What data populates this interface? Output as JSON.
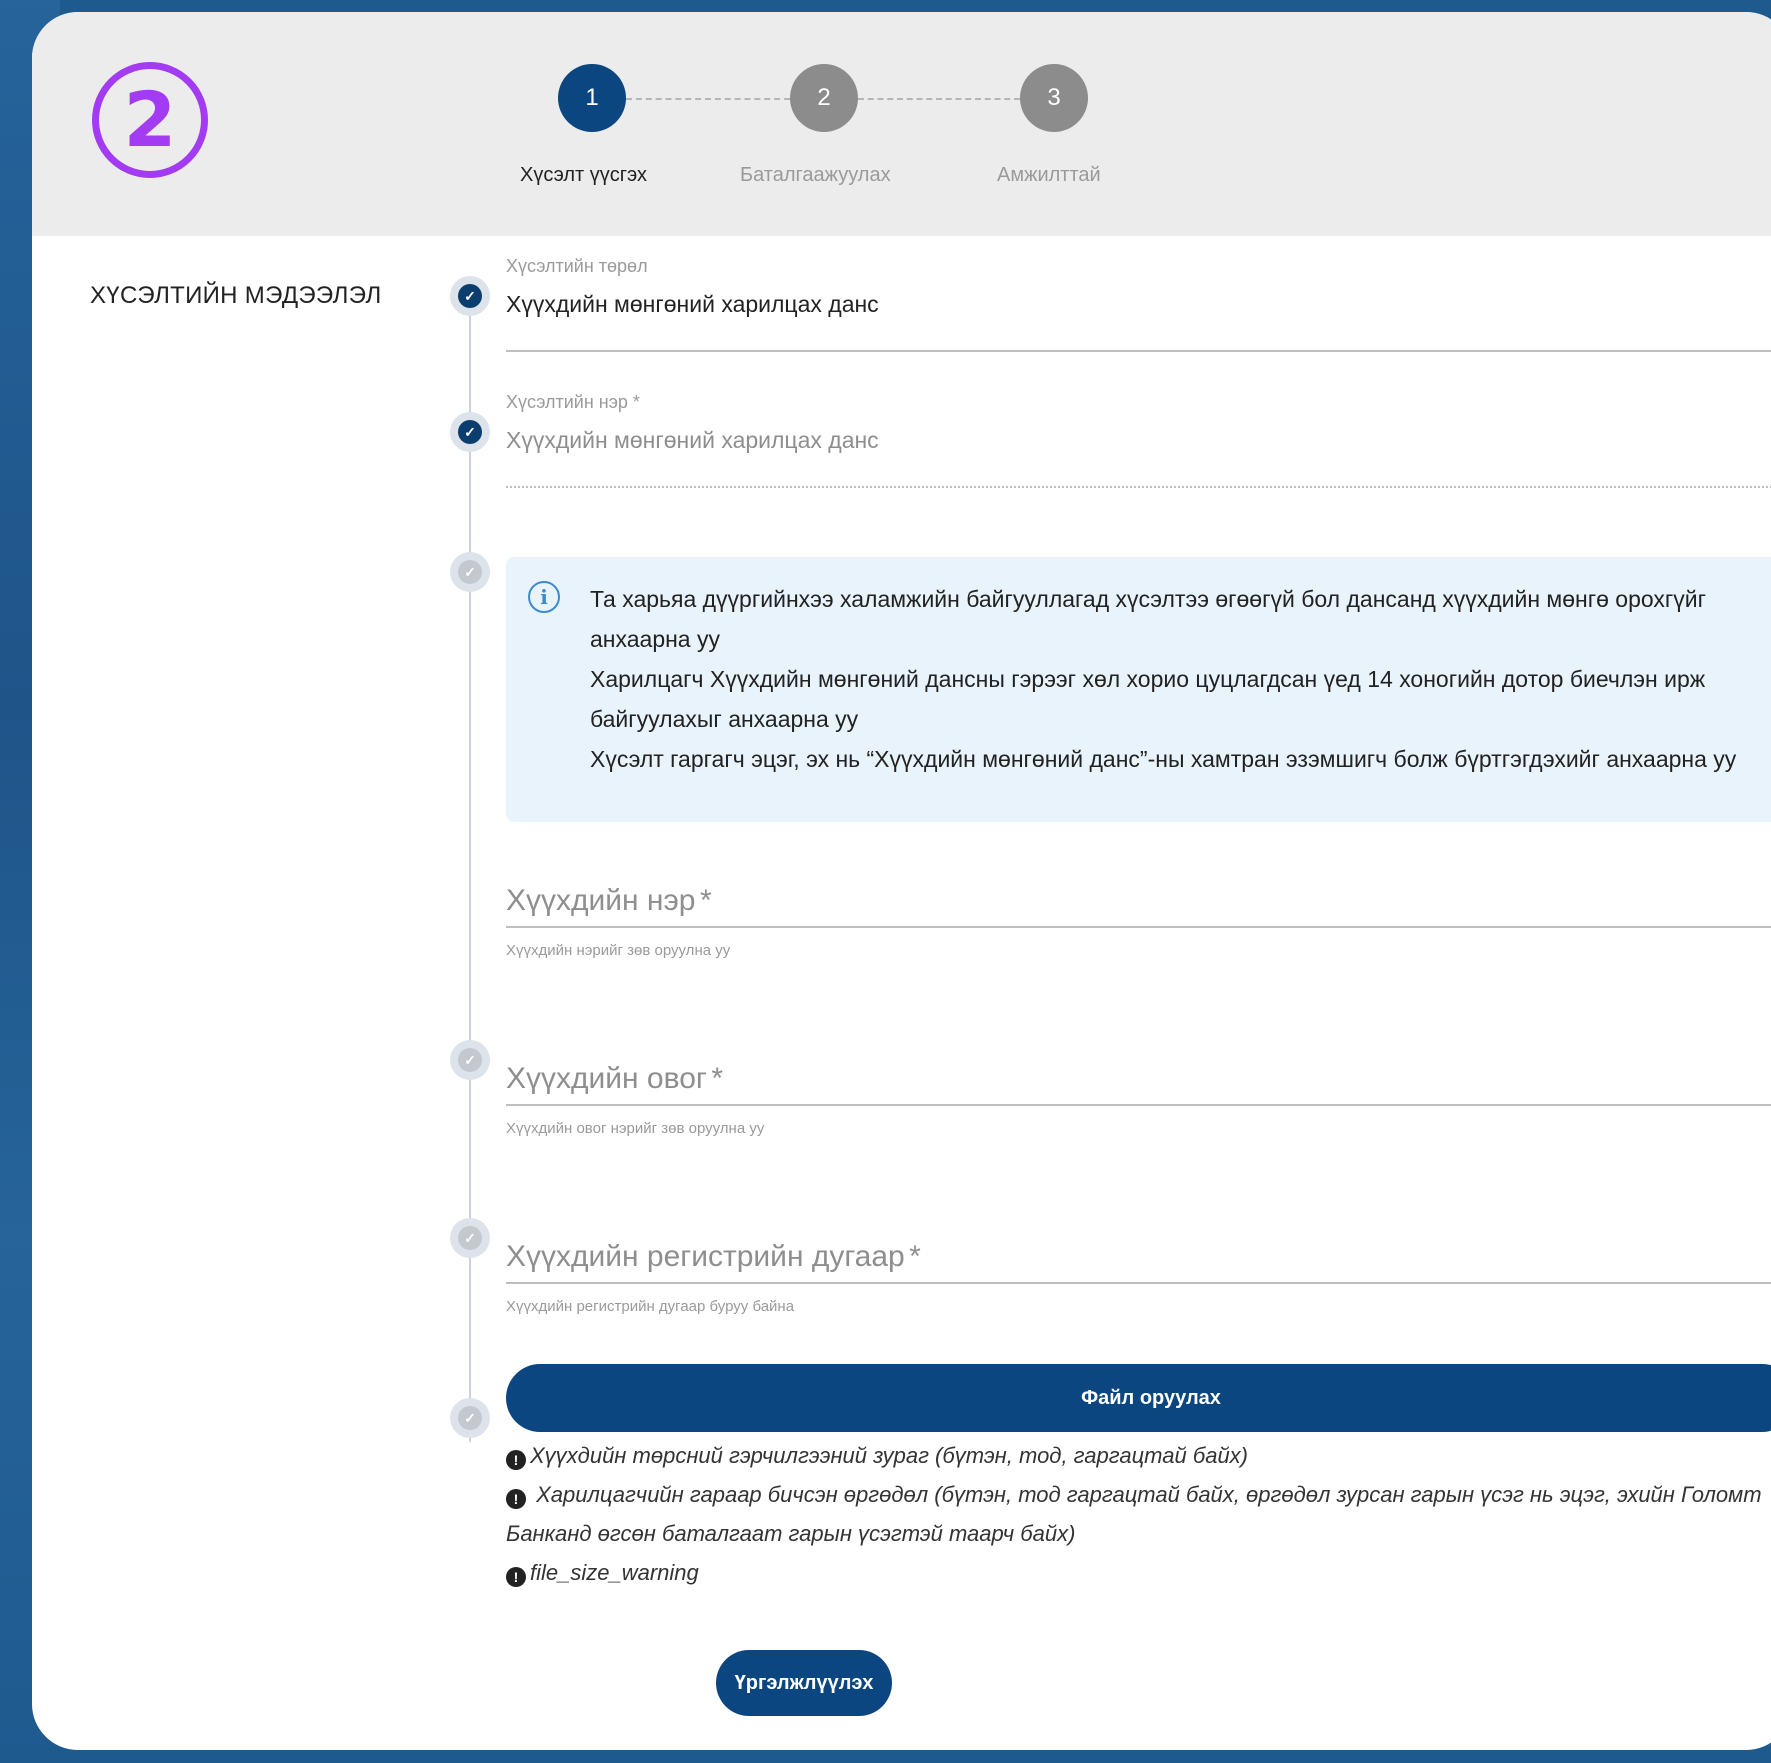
{
  "badge": "2",
  "stepper": {
    "steps": [
      {
        "number": "1",
        "label": "Хүсэлт үүсгэх"
      },
      {
        "number": "2",
        "label": "Баталгаажуулах"
      },
      {
        "number": "3",
        "label": "Амжилттай"
      }
    ],
    "active_step": 1
  },
  "section_title": "ХҮСЭЛТИЙН МЭДЭЭЛЭЛ",
  "request_type": {
    "label": "Хүсэлтийн төрөл",
    "value": "Хүүхдийн мөнгөний харилцах данс"
  },
  "request_name": {
    "label": "Хүсэлтийн нэр *",
    "value": "Хүүхдийн мөнгөний харилцах данс"
  },
  "info": {
    "lines": [
      "Та харьяа дүүргийнхээ халамжийн байгууллагад хүсэлтээ өгөөгүй бол дансанд хүүхдийн мөнгө орохгүйг анхаарна уу",
      "Харилцагч Хүүхдийн мөнгөний дансны гэрээг хөл хорио цуцлагдсан үед 14 хоногийн дотор биечлэн ирж байгуулахыг анхаарна уу",
      "Хүсэлт гаргагч эцэг, эх нь “Хүүхдийн мөнгөний данс”-ны хамтран эзэмшигч болж бүртгэгдэхийг анхаарна уу"
    ]
  },
  "child_name": {
    "label": "Хүүхдийн нэр",
    "required": "*",
    "hint": "Хүүхдийн нэрийг зөв оруулна уу"
  },
  "child_surname": {
    "label": "Хүүхдийн овог",
    "required": "*",
    "hint": "Хүүхдийн овог нэрийг зөв оруулна уу"
  },
  "child_register": {
    "label": "Хүүхдийн регистрийн дугаар",
    "required": "*",
    "hint": "Хүүхдийн регистрийн дугаар буруу байна"
  },
  "file_button": "Файл оруулах",
  "notes": [
    "Хүүхдийн төрсний гэрчилгээний зураг (бүтэн, тод, гаргацтай байх)",
    " Харилцагчийн гараар бичсэн өргөдөл (бүтэн, тод гаргацтай байх, өргөдөл зурсан гарын үсэг нь эцэг, эхийн Голомт Банканд өгсөн баталгаат гарын үсэгтэй таарч байх)",
    "file_size_warning"
  ],
  "continue_button": "Үргэлжлүүлэх",
  "colors": {
    "primary": "#0b4680",
    "badge": "#a23bf2",
    "info_bg": "#e8f3fc",
    "page_bg": "#1f5a8f"
  }
}
